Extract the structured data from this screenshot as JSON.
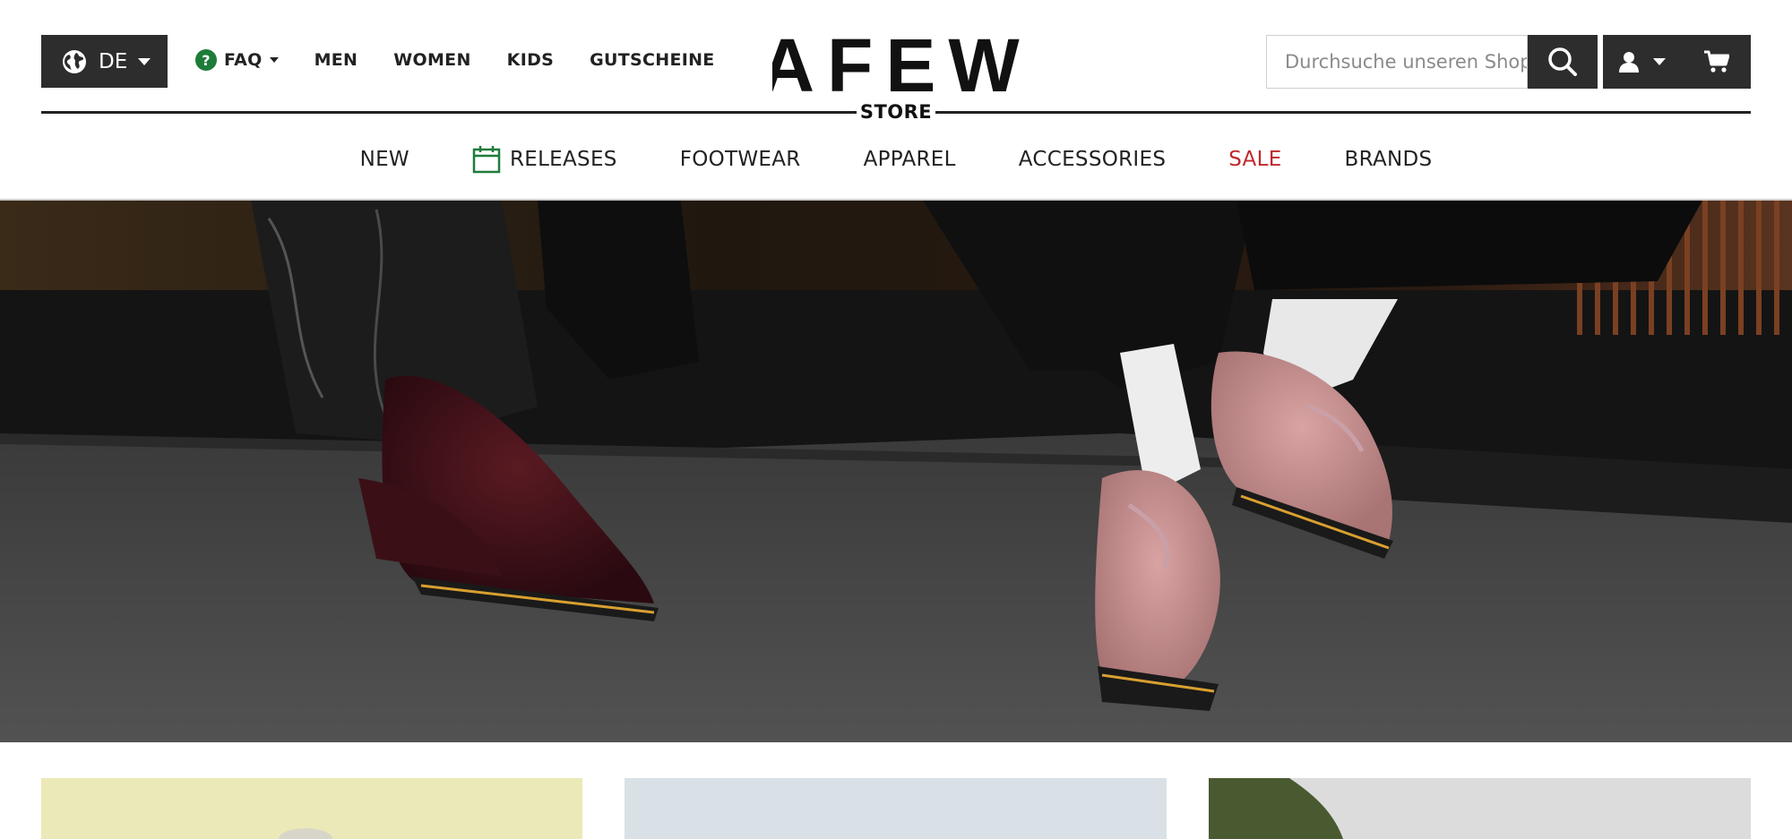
{
  "header": {
    "language": {
      "label": "DE",
      "icon": "globe-icon"
    },
    "top_nav": [
      {
        "label": "FAQ",
        "icon": "question-icon",
        "has_dropdown": true
      },
      {
        "label": "MEN"
      },
      {
        "label": "WOMEN"
      },
      {
        "label": "KIDS"
      },
      {
        "label": "GUTSCHEINE"
      }
    ],
    "logo": {
      "text": "AFEW",
      "sub": "STORE"
    },
    "search": {
      "placeholder": "Durchsuche unseren Shop",
      "icon": "search-icon"
    },
    "account": {
      "icon": "user-icon"
    },
    "cart": {
      "icon": "cart-icon"
    }
  },
  "main_nav": [
    {
      "label": "NEW"
    },
    {
      "label": "RELEASES",
      "icon": "calendar-icon"
    },
    {
      "label": "FOOTWEAR"
    },
    {
      "label": "APPAREL"
    },
    {
      "label": "ACCESSORIES"
    },
    {
      "label": "SALE",
      "highlight": true
    },
    {
      "label": "BRANDS"
    }
  ],
  "colors": {
    "dark": "#2d2d2d",
    "accent_green": "#1e7c3a",
    "sale_red": "#c0282d"
  }
}
